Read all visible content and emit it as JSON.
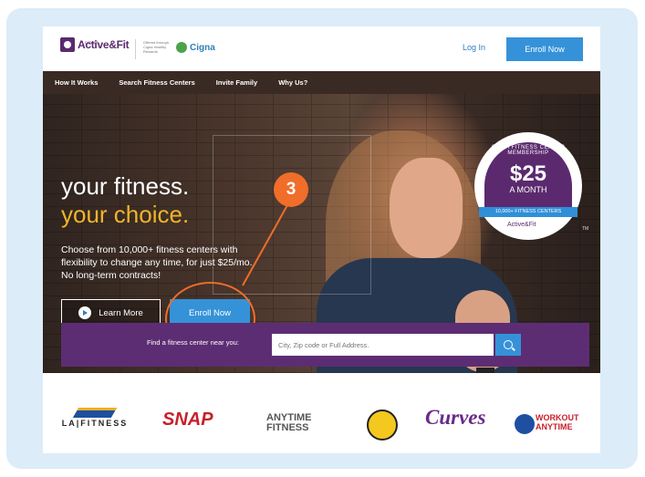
{
  "header": {
    "logo_text": "Active&Fit",
    "logo_sub": "DIRECT",
    "offered_by": "Offered through Cigna Healthy Rewards",
    "partner_logo": "Cigna",
    "login_label": "Log In",
    "enroll_label": "Enroll Now"
  },
  "nav": {
    "items": [
      {
        "label": "How It Works"
      },
      {
        "label": "Search Fitness Centers"
      },
      {
        "label": "Invite Family"
      },
      {
        "label": "Why Us?"
      }
    ]
  },
  "hero": {
    "headline_line1": "your fitness.",
    "headline_line2": "your choice.",
    "subtext": "Choose from 10,000+ fitness centers with flexibility to change any time, for just $25/mo. No long-term contracts!",
    "learn_more_label": "Learn More",
    "enroll_label": "Enroll Now",
    "badge": {
      "top_text": "GET A FITNESS CENTER MEMBERSHIP",
      "price": "$25",
      "period": "A MONTH",
      "strip_text": "10,000+ FITNESS CENTERS",
      "logo_text": "Active&Fit",
      "tm": "TM"
    }
  },
  "annotation": {
    "step_number": "3"
  },
  "search": {
    "label": "Find a fitness center near you:",
    "placeholder": "City, Zip code or Full Address."
  },
  "partners": {
    "la_fitness": "LA|FITNESS",
    "snap": "SNAP",
    "anytime_line1": "ANYTIME",
    "anytime_line2": "FITNESS",
    "curves": "Curves",
    "workout_line1": "WORKOUT",
    "workout_line2": "ANYTIME"
  },
  "colors": {
    "brand_purple": "#5b2a6e",
    "button_blue": "#3592d8",
    "accent_orange": "#f06d2a",
    "headline_gold": "#f0b42a"
  }
}
